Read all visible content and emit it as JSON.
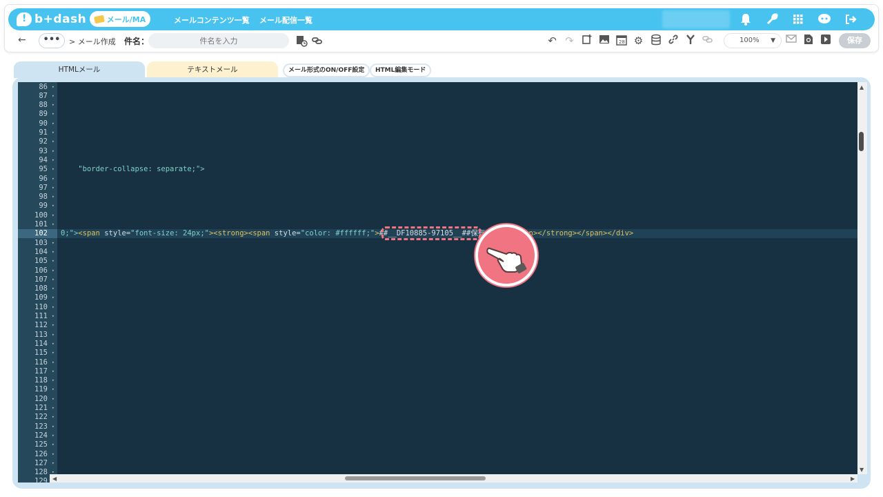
{
  "header": {
    "brand": "b+dash",
    "product_pill": "メール/MA",
    "nav": [
      "メールコンテンツ一覧",
      "メール配信一覧"
    ]
  },
  "toolbar": {
    "more_label": "•••",
    "breadcrumb": "> メール作成",
    "subject_label": "件名：",
    "subject_placeholder": "件名を入力",
    "zoom": "100%",
    "save_label": "保存"
  },
  "tabs": {
    "html": "HTMLメール",
    "text": "テキストメール",
    "format_toggle": "メール形式のON/OFF設定",
    "html_edit_mode": "HTML編集モード"
  },
  "editor": {
    "line_numbers": [
      "86",
      "87",
      "88",
      "89",
      "90",
      "91",
      "92",
      "93",
      "94",
      "95",
      "96",
      "97",
      "98",
      "99",
      "100",
      "101",
      "102",
      "103",
      "104",
      "105",
      "106",
      "107",
      "108",
      "109",
      "110",
      "111",
      "112",
      "113",
      "114",
      "115",
      "116",
      "117",
      "118",
      "119",
      "120",
      "121",
      "122",
      "123",
      "124",
      "125",
      "126",
      "127",
      "128",
      "129"
    ],
    "active_line": "102",
    "line94": "\"border-collapse: separate;\">",
    "line102": {
      "prefix": "0;\">",
      "tag1": "<span",
      "attr1": " style=",
      "val1": "\"font-size: 24px;\"",
      "tag1_close": ">",
      "tag2": "<strong><span",
      "attr2": " style=",
      "val2": "\"color: #ffffff;\"",
      "tag2_close": ">",
      "placeholder": "##__DF10885-97105__##",
      "suffix_text": "保有point",
      "close_tags": "</span></strong></span></div>"
    }
  }
}
